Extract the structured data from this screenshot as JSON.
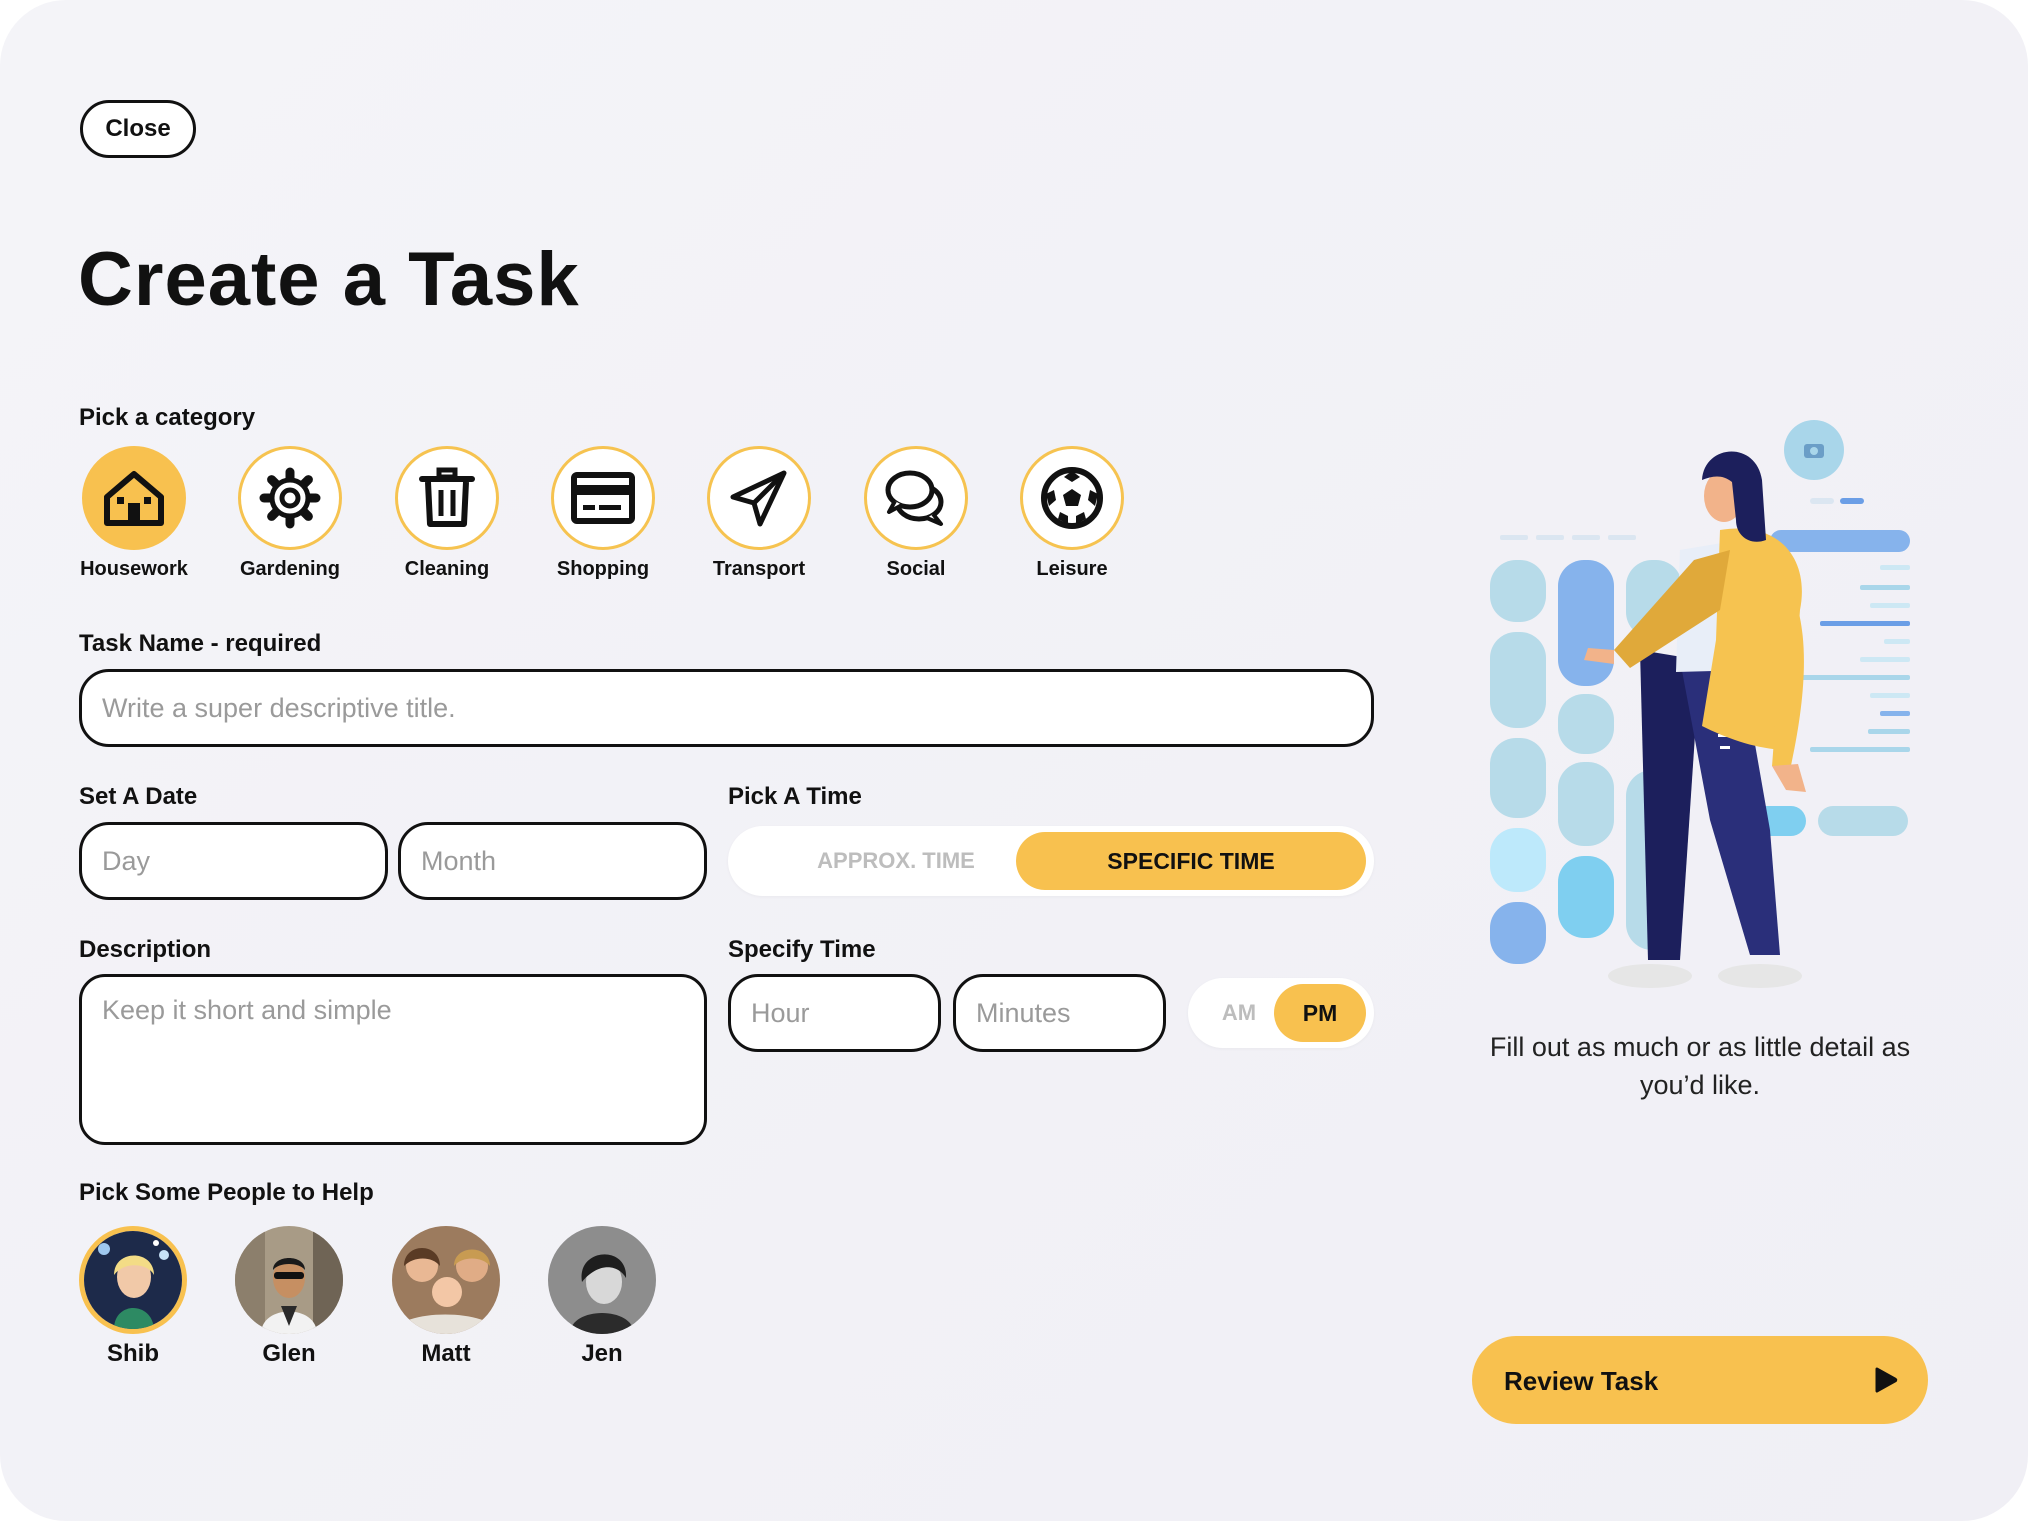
{
  "close_label": "Close",
  "title": "Create a Task",
  "category_section": {
    "label": "Pick a category",
    "selected": "Housework",
    "items": [
      {
        "label": "Housework",
        "icon": "house-icon"
      },
      {
        "label": "Gardening",
        "icon": "gear-icon"
      },
      {
        "label": "Cleaning",
        "icon": "trash-icon"
      },
      {
        "label": "Shopping",
        "icon": "credit-card-icon"
      },
      {
        "label": "Transport",
        "icon": "paper-plane-icon"
      },
      {
        "label": "Social",
        "icon": "chat-bubbles-icon"
      },
      {
        "label": "Leisure",
        "icon": "soccer-ball-icon"
      }
    ]
  },
  "task_name": {
    "label": "Task Name - required",
    "placeholder": "Write a super descriptive title.",
    "value": ""
  },
  "date": {
    "label": "Set A Date",
    "day_placeholder": "Day",
    "month_placeholder": "Month"
  },
  "time": {
    "label": "Pick A Time",
    "approx_label": "APPROX. TIME",
    "specific_label": "SPECIFIC TIME",
    "selected": "SPECIFIC TIME"
  },
  "description": {
    "label": "Description",
    "placeholder": "Keep it short and simple"
  },
  "specify_time": {
    "label": "Specify Time",
    "hour_placeholder": "Hour",
    "minutes_placeholder": "Minutes",
    "am_label": "AM",
    "pm_label": "PM",
    "selected": "PM"
  },
  "people": {
    "label": "Pick Some People to Help",
    "selected": "Shib",
    "items": [
      {
        "name": "Shib"
      },
      {
        "name": "Glen"
      },
      {
        "name": "Matt"
      },
      {
        "name": "Jen"
      }
    ]
  },
  "side_text": "Fill out as much or as little detail as you’d like.",
  "review_label": "Review Task",
  "colors": {
    "accent": "#f8c14f",
    "outline": "#111111",
    "background": "#f2f1f6"
  }
}
